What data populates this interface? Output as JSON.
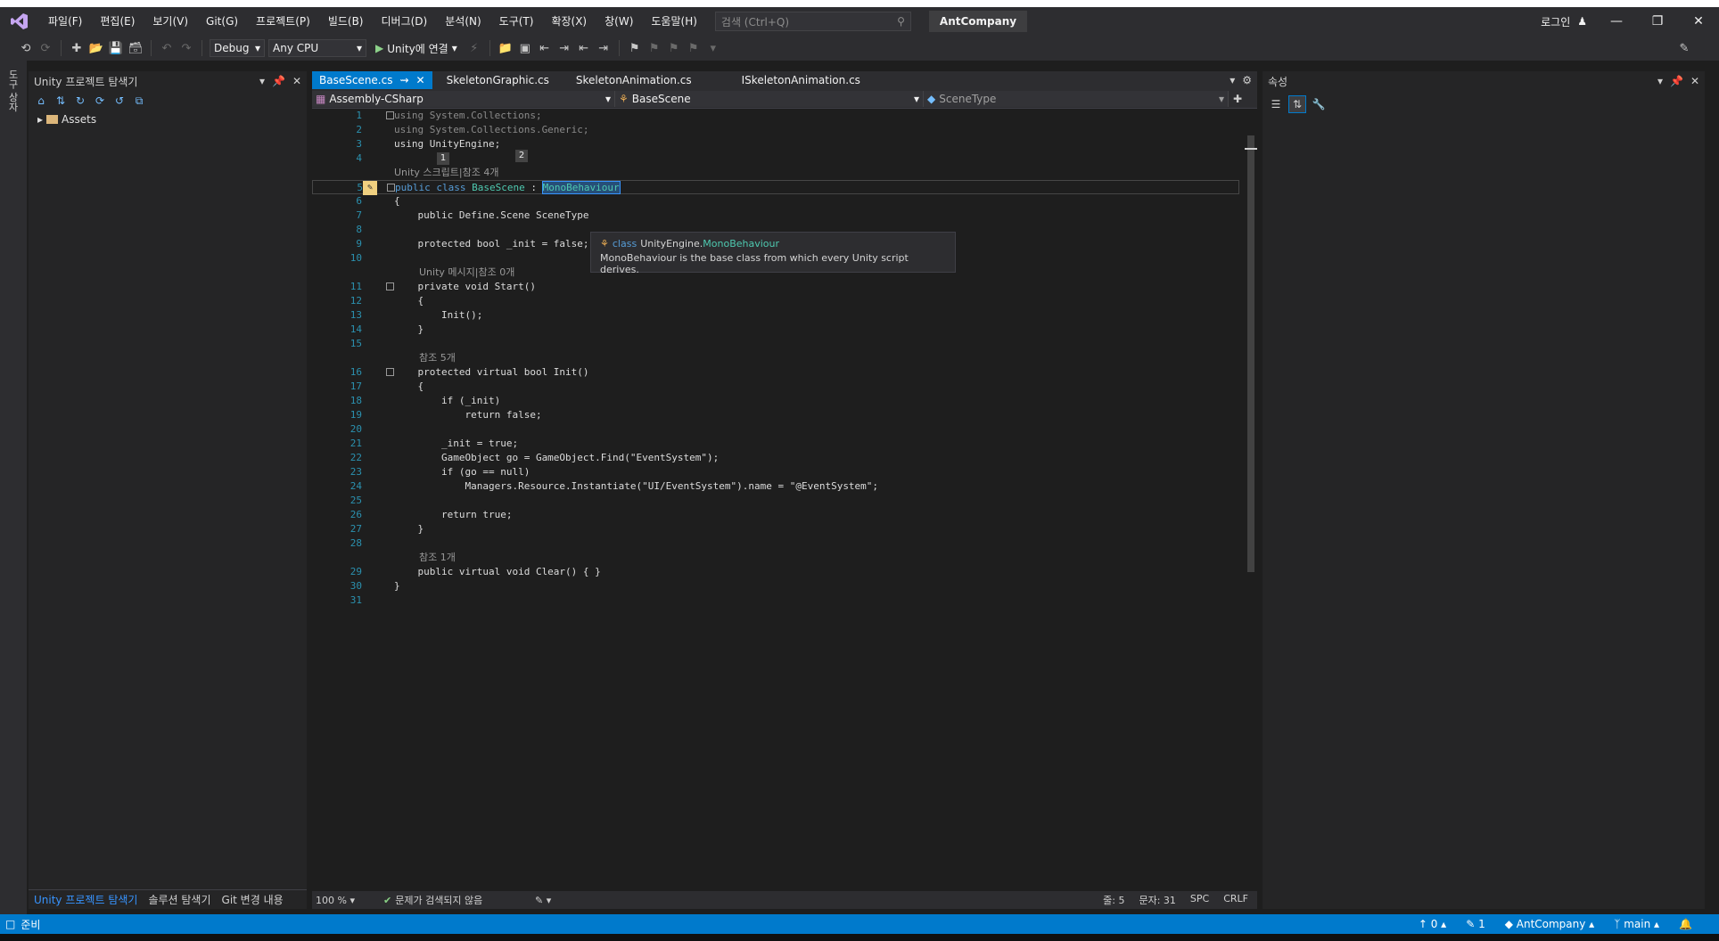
{
  "menubar": {
    "items": [
      "파일(F)",
      "편집(E)",
      "보기(V)",
      "Git(G)",
      "프로젝트(P)",
      "빌드(B)",
      "디버그(D)",
      "분석(N)",
      "도구(T)",
      "확장(X)",
      "창(W)",
      "도움말(H)"
    ],
    "search_placeholder": "검색 (Ctrl+Q)",
    "solution_name": "AntCompany",
    "login": "로그인"
  },
  "toolbar": {
    "config": "Debug",
    "platform": "Any CPU",
    "run_label": "Unity에 연결"
  },
  "left_strip": {
    "label": "도구 상자"
  },
  "solution_explorer": {
    "title": "Unity 프로젝트 탐색기",
    "tree": [
      {
        "label": "Assets"
      }
    ],
    "bottom_tabs": [
      "Unity 프로젝트 탐색기",
      "솔루션 탐색기",
      "Git 변경 내용"
    ]
  },
  "editor": {
    "tabs": [
      "BaseScene.cs",
      "SkeletonGraphic.cs",
      "SkeletonAnimation.cs",
      "ISkeletonAnimation.cs"
    ],
    "nav": {
      "project": "Assembly-CSharp",
      "class": "BaseScene",
      "member": "SceneType"
    },
    "markers": [
      "1",
      "2"
    ],
    "hints": {
      "h1": "Unity 스크립트|참조 4개",
      "h2": "Unity 메시지|참조 0개",
      "h3": "참조 5개",
      "h4": "참조 1개"
    },
    "tooltip": {
      "kind": "class",
      "ns": "UnityEngine.",
      "name": "MonoBehaviour",
      "desc": "MonoBehaviour is the base class from which every Unity script derives."
    },
    "status": {
      "zoom": "100 %",
      "issues": "문제가 검색되지 않음",
      "line": "줄: 5",
      "col": "문자: 31",
      "spc": "SPC",
      "eol": "CRLF"
    }
  },
  "properties": {
    "title": "속성"
  },
  "statusbar": {
    "ready": "준비",
    "up": "0",
    "edits": "1",
    "repo": "AntCompany",
    "branch": "main"
  },
  "code_lines": [
    {
      "n": "1",
      "c": "using System.Collections;"
    },
    {
      "n": "2",
      "c": "using System.Collections.Generic;"
    },
    {
      "n": "3",
      "c": "using UnityEngine;"
    },
    {
      "n": "4",
      "c": ""
    },
    {
      "n": "5",
      "c": "public class BaseScene : MonoBehaviour"
    },
    {
      "n": "6",
      "c": "{"
    },
    {
      "n": "7",
      "c": "    public Define.Scene SceneType"
    },
    {
      "n": "8",
      "c": ""
    },
    {
      "n": "9",
      "c": "    protected bool _init = false;"
    },
    {
      "n": "10",
      "c": ""
    },
    {
      "n": "11",
      "c": "    private void Start()"
    },
    {
      "n": "12",
      "c": "    {"
    },
    {
      "n": "13",
      "c": "        Init();"
    },
    {
      "n": "14",
      "c": "    }"
    },
    {
      "n": "15",
      "c": ""
    },
    {
      "n": "16",
      "c": "    protected virtual bool Init()"
    },
    {
      "n": "17",
      "c": "    {"
    },
    {
      "n": "18",
      "c": "        if (_init)"
    },
    {
      "n": "19",
      "c": "            return false;"
    },
    {
      "n": "20",
      "c": ""
    },
    {
      "n": "21",
      "c": "        _init = true;"
    },
    {
      "n": "22",
      "c": "        GameObject go = GameObject.Find(\"EventSystem\");"
    },
    {
      "n": "23",
      "c": "        if (go == null)"
    },
    {
      "n": "24",
      "c": "            Managers.Resource.Instantiate(\"UI/EventSystem\").name = \"@EventSystem\";"
    },
    {
      "n": "25",
      "c": ""
    },
    {
      "n": "26",
      "c": "        return true;"
    },
    {
      "n": "27",
      "c": "    }"
    },
    {
      "n": "28",
      "c": ""
    },
    {
      "n": "29",
      "c": "    public virtual void Clear() { }"
    },
    {
      "n": "30",
      "c": "}"
    },
    {
      "n": "31",
      "c": ""
    }
  ]
}
